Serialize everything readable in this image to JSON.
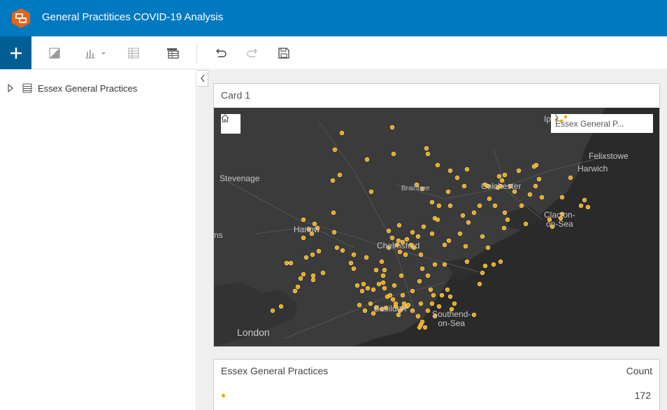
{
  "header": {
    "title": "General Practitices COVID-19 Analysis",
    "logo_icon": "insights-logo-icon",
    "color": "#0079c1"
  },
  "toolbar": {
    "icons": [
      "add-icon",
      "map-icon",
      "chart-icon",
      "table-icon",
      "data-view-icon",
      "undo-icon",
      "redo-icon",
      "save-icon"
    ]
  },
  "sidebar": {
    "dataset_label": "Essex General Practices"
  },
  "card": {
    "title": "Card 1",
    "legend_label": "Essex General P...",
    "point_color": "#f0a500"
  },
  "map_labels": {
    "ipswich": "Ip",
    "felixstowe": "Felixstowe",
    "harwich": "Harwich",
    "stevenage": "Stevenage",
    "braintree": "Braintree",
    "colchester": "Colchester",
    "clacton": "Clacton-\non-Sea",
    "harlow": "Harlow",
    "st_albans": "ns",
    "chelmsford": "Chelmsford",
    "basildon": "Basildon",
    "southend": "Southend-\non-Sea",
    "london": "London"
  },
  "table": {
    "header": "Essex General Practices",
    "count_header": "Count",
    "rows": [
      {
        "value": "172"
      }
    ]
  }
}
